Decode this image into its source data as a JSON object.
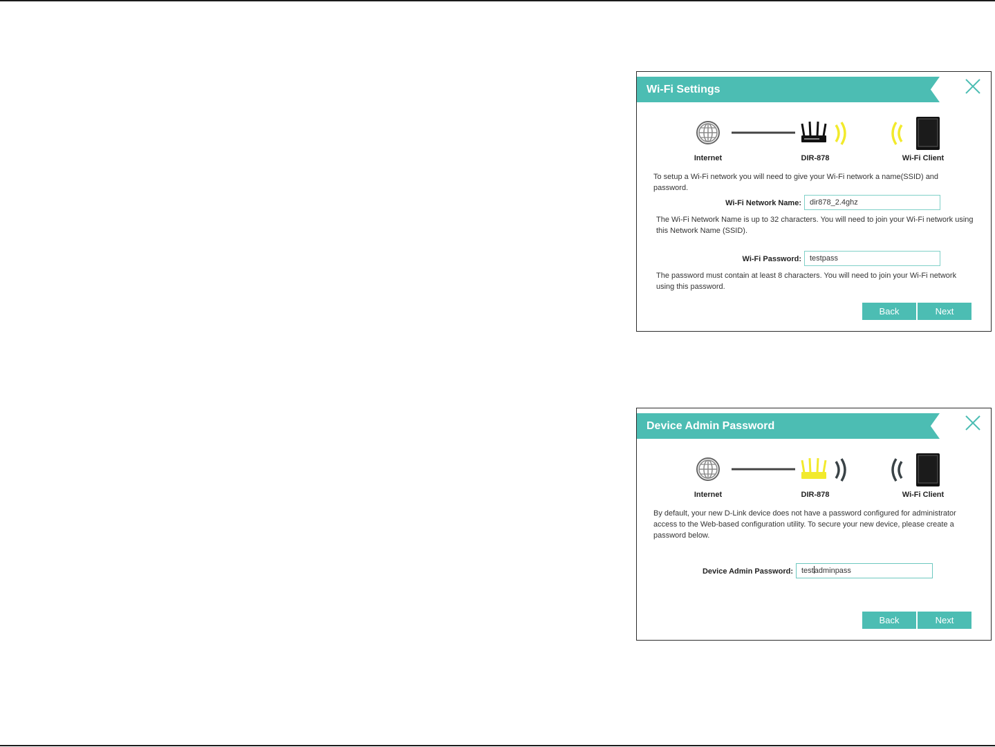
{
  "wifi_panel": {
    "title": "Wi-Fi Settings",
    "diagram": {
      "internet_label": "Internet",
      "router_label": "DIR-878",
      "client_label": "Wi-Fi Client",
      "highlight_color": "#f2ea2c"
    },
    "intro": "To setup a Wi-Fi network you will need to give your Wi-Fi network a name(SSID) and password.",
    "network_name_label": "Wi-Fi Network Name:",
    "network_name_value": "dir878_2.4ghz",
    "network_name_help": "The Wi-Fi Network Name is up to 32 characters. You will need to join your Wi-Fi network using this Network Name (SSID).",
    "password_label": "Wi-Fi Password:",
    "password_value": "testpass",
    "password_help": "The password must contain at least 8 characters. You will need to join your Wi-Fi network using this password.",
    "back_label": "Back",
    "next_label": "Next"
  },
  "admin_panel": {
    "title": "Device Admin Password",
    "diagram": {
      "internet_label": "Internet",
      "router_label": "DIR-878",
      "client_label": "Wi-Fi Client",
      "highlight_color": "#f2ea2c"
    },
    "intro": "By default, your new D-Link device does not have a password configured for administrator access to the Web-based configuration utility. To secure your new device, please create a password below.",
    "admin_password_label": "Device Admin Password:",
    "admin_password_value_pre": "test",
    "admin_password_value_post": "adminpass",
    "back_label": "Back",
    "next_label": "Next"
  },
  "colors": {
    "accent": "#4cbdb3",
    "highlight": "#f2ea2c",
    "border": "#2a2a2a"
  }
}
